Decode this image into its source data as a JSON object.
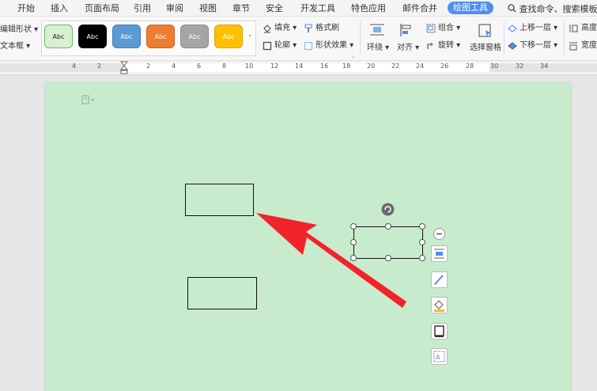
{
  "tabs": [
    {
      "label": "开始",
      "active": false
    },
    {
      "label": "插入",
      "active": false
    },
    {
      "label": "页面布局",
      "active": false
    },
    {
      "label": "引用",
      "active": false
    },
    {
      "label": "审阅",
      "active": false
    },
    {
      "label": "视图",
      "active": false
    },
    {
      "label": "章节",
      "active": false
    },
    {
      "label": "安全",
      "active": false
    },
    {
      "label": "开发工具",
      "active": false
    },
    {
      "label": "特色应用",
      "active": false
    },
    {
      "label": "邮件合并",
      "active": false
    },
    {
      "label": "绘图工具",
      "active": true
    }
  ],
  "search": {
    "label": "查找命令、搜索模板",
    "icon": "search-icon"
  },
  "ribbon": {
    "edit_shape": "编辑形状",
    "textbox": "文本框",
    "styles": [
      {
        "label": "Abc",
        "fill": "#d7f0d2",
        "border": "#6fb66a",
        "text": "#222222"
      },
      {
        "label": "Abc",
        "fill": "#000000",
        "border": "#000000",
        "text": "#ffffff"
      },
      {
        "label": "Abc",
        "fill": "#5b9bd5",
        "border": "#3f7fb8",
        "text": "#ffffff"
      },
      {
        "label": "Abc",
        "fill": "#ed7d31",
        "border": "#c9651f",
        "text": "#ffffff"
      },
      {
        "label": "Abc",
        "fill": "#a5a5a5",
        "border": "#8a8a8a",
        "text": "#ffffff"
      },
      {
        "label": "Abc",
        "fill": "#ffc000",
        "border": "#d9a300",
        "text": "#ffffff"
      }
    ],
    "fill": "填充",
    "format_painter": "格式刷",
    "outline": "轮廓",
    "shape_effects": "形状效果",
    "wrap": "环绕",
    "align": "对齐",
    "group": "组合",
    "rotate": "旋转",
    "selection_pane": "选择窗格",
    "bring_forward": "上移一层",
    "send_backward": "下移一层",
    "height": "高度",
    "width": "宽度"
  },
  "ruler": {
    "labels": [
      "4",
      "2",
      "2",
      "4",
      "6",
      "8",
      "10",
      "12",
      "14",
      "16",
      "18",
      "20",
      "22",
      "24",
      "26",
      "28",
      "30",
      "32",
      "34"
    ]
  },
  "colors": {
    "page_bg": "#c8ebce",
    "accent": "#4d8ef0",
    "arrow": "#f2232a"
  },
  "float_toolbar": [
    "collapse-icon",
    "layout-options-icon",
    "shape-style-icon",
    "fill-icon",
    "outline-icon",
    "text-wrap-icon"
  ]
}
